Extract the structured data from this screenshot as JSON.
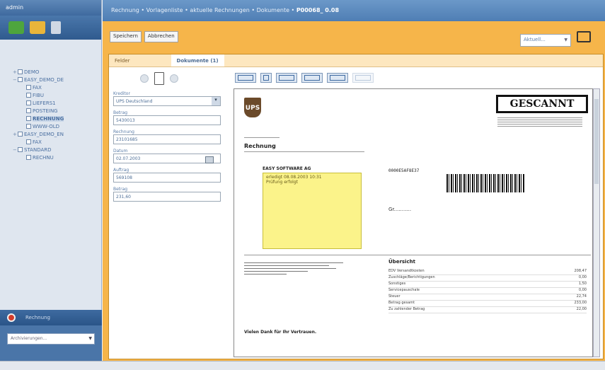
{
  "left": {
    "header": "admin",
    "tree": [
      {
        "label": "DEMO",
        "level": 0,
        "expander": "+"
      },
      {
        "label": "EASY_DEMO_DE",
        "level": 0,
        "expander": "−"
      },
      {
        "label": "FAX",
        "level": 1
      },
      {
        "label": "FIBU",
        "level": 1
      },
      {
        "label": "LIEFERS1",
        "level": 1
      },
      {
        "label": "POSTEING",
        "level": 1
      },
      {
        "label": "RECHNUNG",
        "level": 1,
        "selected": true
      },
      {
        "label": "WWW-OLD",
        "level": 1
      },
      {
        "label": "EASY_DEMO_EN",
        "level": 0,
        "expander": "+"
      },
      {
        "label": "FAX",
        "level": 1
      },
      {
        "label": "STANDARD",
        "level": 0,
        "expander": "−"
      },
      {
        "label": "RECHNU",
        "level": 1
      }
    ],
    "bottom_label": "Rechnung",
    "bottom_select": "Archivierungen..."
  },
  "pathbar": {
    "text": "Rechnung • Vorlagenliste • aktuelle Rechnungen • Dokumente •",
    "current": "P00068_ 0.08"
  },
  "toolbar": {
    "save_label": "Speichern",
    "delete_label": "Abbrechen",
    "status_select": "Aktuell..."
  },
  "tabs": [
    {
      "label": "Felder",
      "active": false
    },
    {
      "label": "Dokumente (1)",
      "active": true
    }
  ],
  "form": {
    "fields": [
      {
        "label": "Kreditor",
        "value": "UPS Deutschland",
        "type": "select"
      },
      {
        "label": "Betrag",
        "value": "5430013",
        "type": "text"
      },
      {
        "label": "Rechnung",
        "value": "23101685",
        "type": "text"
      },
      {
        "label": "Datum",
        "value": "02.07.2003",
        "type": "date"
      },
      {
        "label": "Auftrag",
        "value": "569108",
        "type": "text"
      },
      {
        "label": "Betrag",
        "value": "231,60",
        "type": "text"
      }
    ]
  },
  "document": {
    "logo": "UPS",
    "stamp": "GESCANNT",
    "title": "Rechnung",
    "company_line": "EASY SOFTWARE AG",
    "note_lines": [
      "erledigt 08.08.2003 10:31",
      "Prüfung erfolgt"
    ],
    "customer_no": "0000E5AF8E37",
    "signature": "Gr...........",
    "summary_title": "Übersicht",
    "footer_bold": "Vielen Dank für Ihr Vertrauen.",
    "summary_rows": [
      {
        "label": "EDV Versandtkosten",
        "value": "208,47"
      },
      {
        "label": "Zuschläge/Berichtigungen",
        "value": "0,00"
      },
      {
        "label": "Sonstiges",
        "value": "1,50"
      },
      {
        "label": "Servicepauschale",
        "value": "0,00"
      },
      {
        "label": "Steuer",
        "value": "22,74"
      },
      {
        "label": "Betrag gesamt",
        "value": "233,00"
      },
      {
        "label": "Zu zahlender Betrag",
        "value": "22,00"
      }
    ]
  }
}
